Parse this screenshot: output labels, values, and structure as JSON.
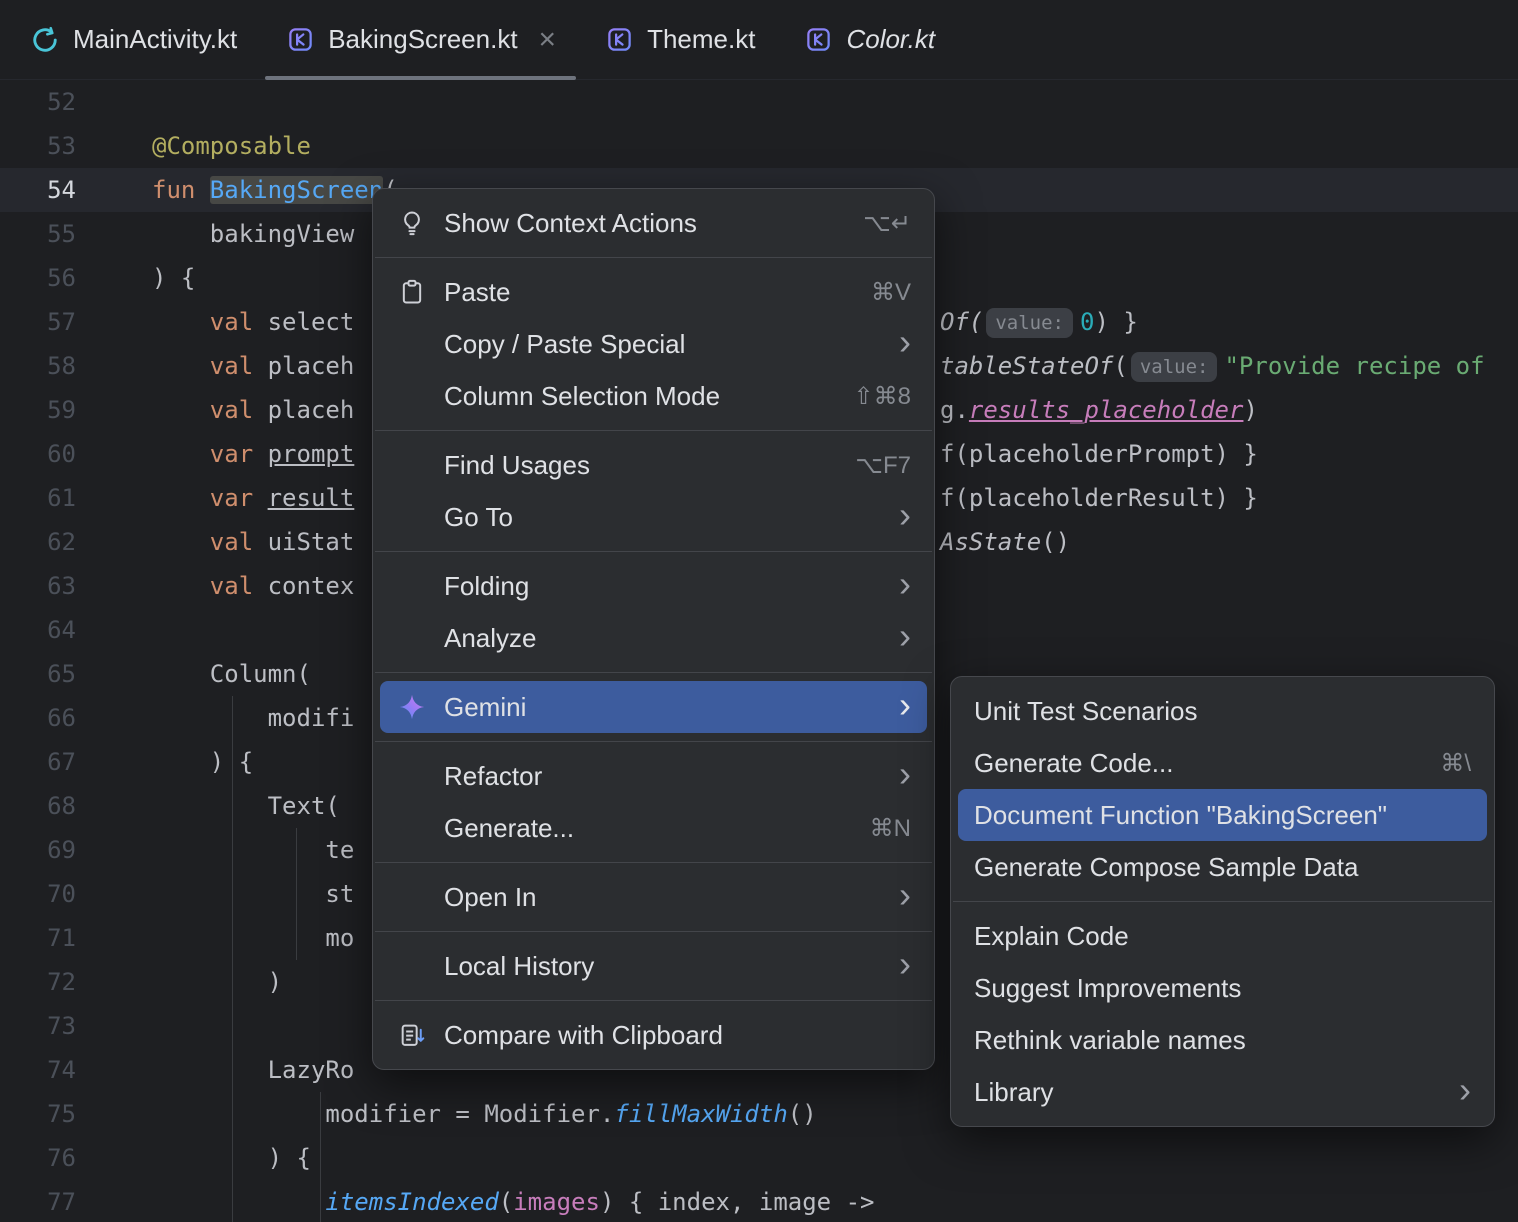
{
  "colors": {
    "editor_bg": "#1e1f22",
    "menu_bg": "#2b2d30",
    "menu_border": "#46484d",
    "menu_selection": "#3d5c9e",
    "current_line": "#26282e",
    "keyword": "#cf8e6d",
    "function": "#56a8f5",
    "annotation": "#b3ae60",
    "string": "#6aab73",
    "number": "#2aacb8",
    "property": "#c77dbb",
    "line_number": "#4b5059",
    "tab_underline": "#6e737d"
  },
  "tabs": [
    {
      "label": "MainActivity.kt",
      "icon": "compose-activity-icon",
      "active": false,
      "italic": false,
      "closable": false
    },
    {
      "label": "BakingScreen.kt",
      "icon": "kotlin-file-icon",
      "active": true,
      "italic": false,
      "closable": true
    },
    {
      "label": "Theme.kt",
      "icon": "kotlin-file-icon",
      "active": false,
      "italic": false,
      "closable": false
    },
    {
      "label": "Color.kt",
      "icon": "kotlin-file-icon",
      "active": false,
      "italic": true,
      "closable": false
    }
  ],
  "editor": {
    "lines": [
      {
        "num": 52,
        "segs": []
      },
      {
        "num": 53,
        "segs": [
          {
            "t": "@Composable",
            "c": "ann"
          }
        ]
      },
      {
        "num": 54,
        "current": true,
        "segs": [
          {
            "t": "fun ",
            "c": "kw"
          },
          {
            "t": "BakingScreen",
            "c": "fn sel"
          },
          {
            "t": "(",
            "c": "def"
          }
        ]
      },
      {
        "num": 55,
        "segs": [
          {
            "t": "    bakingView",
            "c": "def"
          }
        ]
      },
      {
        "num": 56,
        "segs": [
          {
            "t": ") {",
            "c": "def"
          }
        ]
      },
      {
        "num": 57,
        "segs": [
          {
            "t": "    ",
            "c": "def"
          },
          {
            "t": "val",
            "c": "kw"
          },
          {
            "t": " select",
            "c": "def"
          }
        ],
        "right": [
          {
            "t": "Of(",
            "c": "it"
          },
          {
            "chip": "value:"
          },
          {
            "t": "0",
            "c": "num"
          },
          {
            "t": ") }",
            "c": "def"
          }
        ]
      },
      {
        "num": 58,
        "segs": [
          {
            "t": "    ",
            "c": "def"
          },
          {
            "t": "val",
            "c": "kw"
          },
          {
            "t": " placeh",
            "c": "def"
          }
        ],
        "right": [
          {
            "t": "tableStateOf",
            "c": "it"
          },
          {
            "t": "(",
            "c": "def"
          },
          {
            "chip": "value:"
          },
          {
            "t": "\"Provide recipe of",
            "c": "str"
          }
        ]
      },
      {
        "num": 59,
        "segs": [
          {
            "t": "    ",
            "c": "def"
          },
          {
            "t": "val",
            "c": "kw"
          },
          {
            "t": " placeh",
            "c": "def"
          }
        ],
        "right": [
          {
            "t": "g.",
            "c": "def"
          },
          {
            "t": "results_placeholder",
            "c": "prop"
          },
          {
            "t": ")",
            "c": "def"
          }
        ]
      },
      {
        "num": 60,
        "segs": [
          {
            "t": "    ",
            "c": "def"
          },
          {
            "t": "var",
            "c": "kw"
          },
          {
            "t": " ",
            "c": "def"
          },
          {
            "t": "prompt",
            "c": "und"
          }
        ],
        "right": [
          {
            "t": "f(placeholderPrompt) }",
            "c": "def"
          }
        ]
      },
      {
        "num": 61,
        "segs": [
          {
            "t": "    ",
            "c": "def"
          },
          {
            "t": "var",
            "c": "kw"
          },
          {
            "t": " ",
            "c": "def"
          },
          {
            "t": "result",
            "c": "und"
          }
        ],
        "right": [
          {
            "t": "f(placeholderResult) }",
            "c": "def"
          }
        ]
      },
      {
        "num": 62,
        "segs": [
          {
            "t": "    ",
            "c": "def"
          },
          {
            "t": "val",
            "c": "kw"
          },
          {
            "t": " uiStat",
            "c": "def"
          }
        ],
        "right": [
          {
            "t": "AsState",
            "c": "it"
          },
          {
            "t": "()",
            "c": "def"
          }
        ]
      },
      {
        "num": 63,
        "segs": [
          {
            "t": "    ",
            "c": "def"
          },
          {
            "t": "val",
            "c": "kw"
          },
          {
            "t": " contex",
            "c": "def"
          }
        ]
      },
      {
        "num": 64,
        "segs": []
      },
      {
        "num": 65,
        "segs": [
          {
            "t": "    Column(",
            "c": "def"
          }
        ]
      },
      {
        "num": 66,
        "segs": [
          {
            "t": "        modifi",
            "c": "def"
          }
        ]
      },
      {
        "num": 67,
        "segs": [
          {
            "t": "    ) {",
            "c": "def"
          }
        ]
      },
      {
        "num": 68,
        "segs": [
          {
            "t": "        Text(",
            "c": "def"
          }
        ]
      },
      {
        "num": 69,
        "segs": [
          {
            "t": "            te",
            "c": "def"
          }
        ]
      },
      {
        "num": 70,
        "segs": [
          {
            "t": "            st",
            "c": "def"
          }
        ]
      },
      {
        "num": 71,
        "segs": [
          {
            "t": "            mo",
            "c": "def"
          }
        ]
      },
      {
        "num": 72,
        "segs": [
          {
            "t": "        )",
            "c": "def"
          }
        ]
      },
      {
        "num": 73,
        "segs": []
      },
      {
        "num": 74,
        "segs": [
          {
            "t": "        LazyRo",
            "c": "def"
          }
        ]
      },
      {
        "num": 75,
        "segs": [
          {
            "t": "            modifier = Modifier.",
            "c": "def"
          },
          {
            "t": "fillMaxWidth",
            "c": "fni"
          },
          {
            "t": "()",
            "c": "def"
          }
        ]
      },
      {
        "num": 76,
        "segs": [
          {
            "t": "        ) {",
            "c": "def"
          }
        ]
      },
      {
        "num": 77,
        "segs": [
          {
            "t": "            ",
            "c": "def"
          },
          {
            "t": "itemsIndexed",
            "c": "fni"
          },
          {
            "t": "(",
            "c": "def"
          },
          {
            "t": "images",
            "c": "param"
          },
          {
            "t": ") { index, image ->",
            "c": "def"
          }
        ]
      }
    ]
  },
  "context_menu": {
    "items": [
      {
        "label": "Show Context Actions",
        "shortcut": "⌥↵",
        "icon": "lightbulb-icon"
      },
      {
        "type": "separator"
      },
      {
        "label": "Paste",
        "shortcut": "⌘V",
        "icon": "paste-icon"
      },
      {
        "label": "Copy / Paste Special",
        "submenu": true
      },
      {
        "label": "Column Selection Mode",
        "shortcut": "⇧⌘8"
      },
      {
        "type": "separator"
      },
      {
        "label": "Find Usages",
        "shortcut": "⌥F7"
      },
      {
        "label": "Go To",
        "submenu": true
      },
      {
        "type": "separator"
      },
      {
        "label": "Folding",
        "submenu": true
      },
      {
        "label": "Analyze",
        "submenu": true
      },
      {
        "type": "separator"
      },
      {
        "label": "Gemini",
        "submenu": true,
        "icon": "gemini-sparkle-icon",
        "selected": true
      },
      {
        "type": "separator"
      },
      {
        "label": "Refactor",
        "submenu": true
      },
      {
        "label": "Generate...",
        "shortcut": "⌘N"
      },
      {
        "type": "separator"
      },
      {
        "label": "Open In",
        "submenu": true
      },
      {
        "type": "separator"
      },
      {
        "label": "Local History",
        "submenu": true
      },
      {
        "type": "separator"
      },
      {
        "label": "Compare with Clipboard",
        "icon": "compare-clipboard-icon"
      }
    ]
  },
  "gemini_submenu": {
    "items": [
      {
        "label": "Unit Test Scenarios"
      },
      {
        "label": "Generate Code...",
        "shortcut": "⌘\\"
      },
      {
        "label": "Document Function \"BakingScreen\"",
        "selected": true
      },
      {
        "label": "Generate Compose Sample Data"
      },
      {
        "type": "separator"
      },
      {
        "label": "Explain Code"
      },
      {
        "label": "Suggest Improvements"
      },
      {
        "label": "Rethink variable names"
      },
      {
        "label": "Library",
        "submenu": true
      }
    ]
  }
}
